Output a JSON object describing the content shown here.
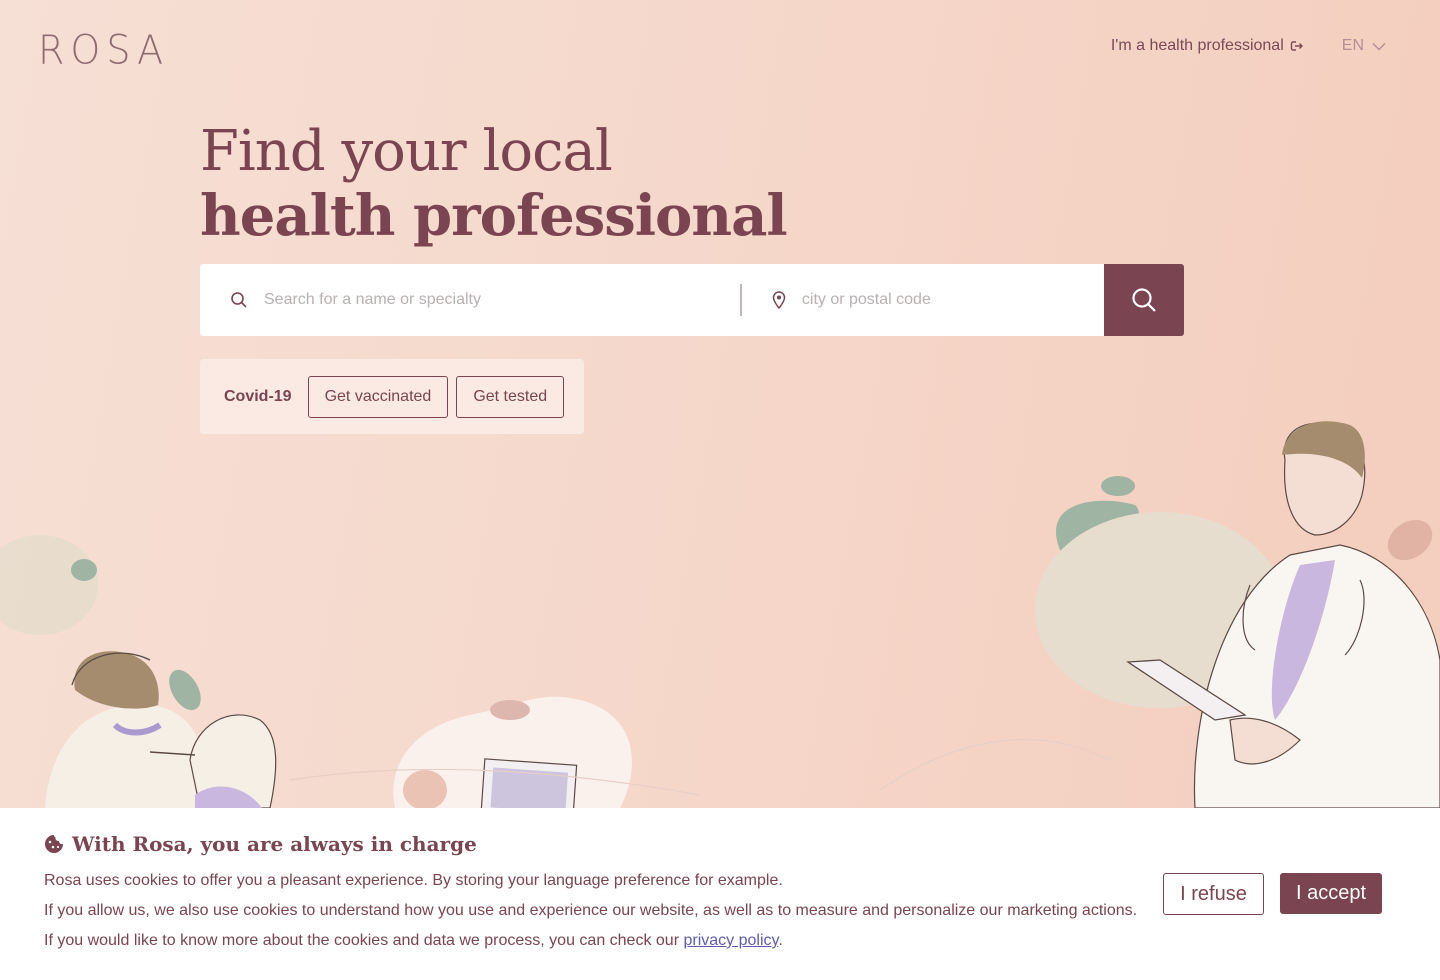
{
  "header": {
    "logo": "ROSA",
    "pro_link": "I'm a health professional",
    "language": "EN"
  },
  "hero": {
    "title_line1": "Find your local",
    "title_line2": "health professional"
  },
  "search": {
    "name_placeholder": "Search for a name or specialty",
    "city_placeholder": "city or postal code"
  },
  "covid": {
    "label": "Covid-19",
    "vaccinated_label": "Get vaccinated",
    "tested_label": "Get tested"
  },
  "cookie": {
    "title": "With Rosa, you are always in charge",
    "line1": "Rosa uses cookies to offer you a pleasant experience. By storing your language preference for example.",
    "line2": "If you allow us, we also use cookies to understand how you use and experience our website, as well as to measure and personalize our marketing actions.",
    "line3_prefix": "If you would like to know more about the cookies and data we process, you can check our ",
    "privacy_link": "privacy policy",
    "line3_suffix": ".",
    "refuse_label": "I refuse",
    "accept_label": "I accept"
  },
  "colors": {
    "brand": "#7b4451",
    "background": "#f5d8cb",
    "link": "#5e5bb4"
  },
  "icons": [
    "search-icon",
    "location-pin-icon",
    "external-link-icon",
    "chevron-down-icon",
    "cookie-icon"
  ]
}
